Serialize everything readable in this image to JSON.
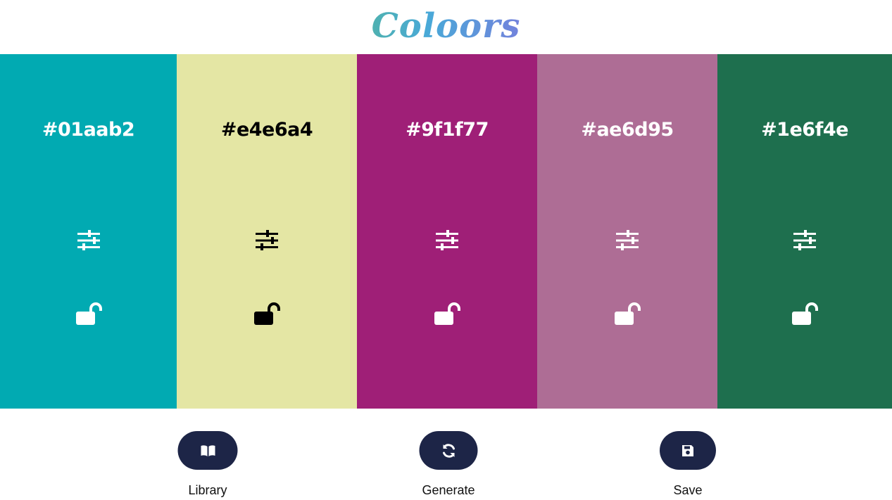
{
  "app": {
    "logo_text": "Coloors"
  },
  "palette": [
    {
      "hex": "#01aab2",
      "bg": "#01aab2",
      "fg": "#ffffff"
    },
    {
      "hex": "#e4e6a4",
      "bg": "#e4e6a4",
      "fg": "#000000"
    },
    {
      "hex": "#9f1f77",
      "bg": "#9f1f77",
      "fg": "#ffffff"
    },
    {
      "hex": "#ae6d95",
      "bg": "#ae6d95",
      "fg": "#ffffff"
    },
    {
      "hex": "#1e6f4e",
      "bg": "#1e6f4e",
      "fg": "#ffffff"
    }
  ],
  "actions": {
    "library": {
      "label": "Library",
      "icon": "book-open-icon"
    },
    "generate": {
      "label": "Generate",
      "icon": "refresh-icon"
    },
    "save": {
      "label": "Save",
      "icon": "floppy-disk-icon"
    }
  },
  "colors": {
    "button_bg": "#1d2547",
    "button_icon": "#ffffff"
  }
}
